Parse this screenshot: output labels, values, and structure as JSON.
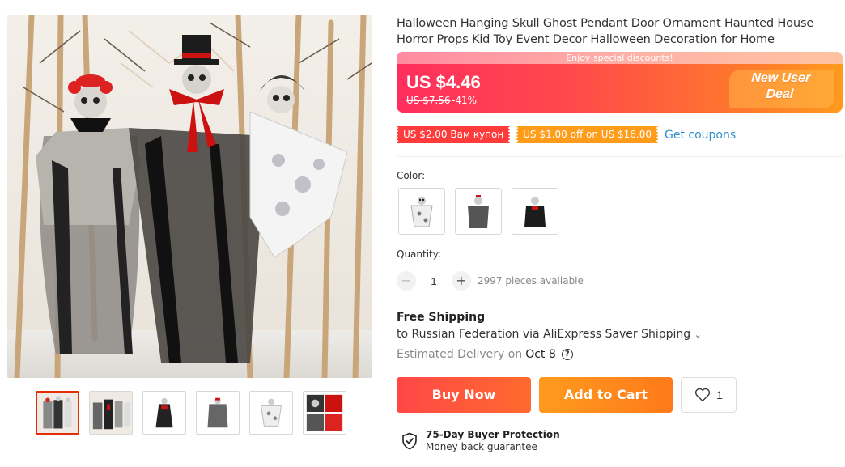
{
  "product": {
    "title": "Halloween Hanging Skull Ghost Pendant Door Ornament Haunted House Horror Props Kid Toy Event Decor Halloween Decoration for Home"
  },
  "gallery": {
    "main_image": "halloween-hanging-skeleton-ghosts-photo",
    "thumbnails": [
      {
        "name": "thumb-three-ghosts",
        "active": true
      },
      {
        "name": "thumb-ghosts-group",
        "active": false
      },
      {
        "name": "thumb-black-red-ghost",
        "active": false
      },
      {
        "name": "thumb-grey-ghost",
        "active": false
      },
      {
        "name": "thumb-white-ghost",
        "active": false
      },
      {
        "name": "thumb-detail-closeup",
        "active": false
      }
    ]
  },
  "price": {
    "banner": "Enjoy special discounts!",
    "current": "US $4.46",
    "original": "US $7.56",
    "discount": "-41%",
    "promo_line1": "New User",
    "promo_line2": "Deal"
  },
  "coupons": {
    "coupon1": "US $2.00 Вам купон",
    "coupon2": "US $1.00 off on US $16.00",
    "link": "Get coupons"
  },
  "color": {
    "label": "Color:",
    "options": [
      "white-ghost",
      "grey-ghost",
      "black-red-ghost"
    ]
  },
  "quantity": {
    "label": "Quantity:",
    "minus": "−",
    "value": "1",
    "plus": "+",
    "available": "2997 pieces available"
  },
  "shipping": {
    "title": "Free Shipping",
    "line": "to Russian Federation via AliExpress Saver Shipping",
    "delivery_label": "Estimated Delivery on",
    "delivery_date": "Oct 8",
    "help": "?"
  },
  "actions": {
    "buy_now": "Buy Now",
    "add_to_cart": "Add to Cart",
    "wishlist_count": "1"
  },
  "protection": {
    "title": "75-Day Buyer Protection",
    "subtitle": "Money back guarantee"
  },
  "colors": {
    "accent_red": "#ff4747",
    "accent_orange": "#ff9a1e",
    "link_blue": "#2f8fcf"
  }
}
